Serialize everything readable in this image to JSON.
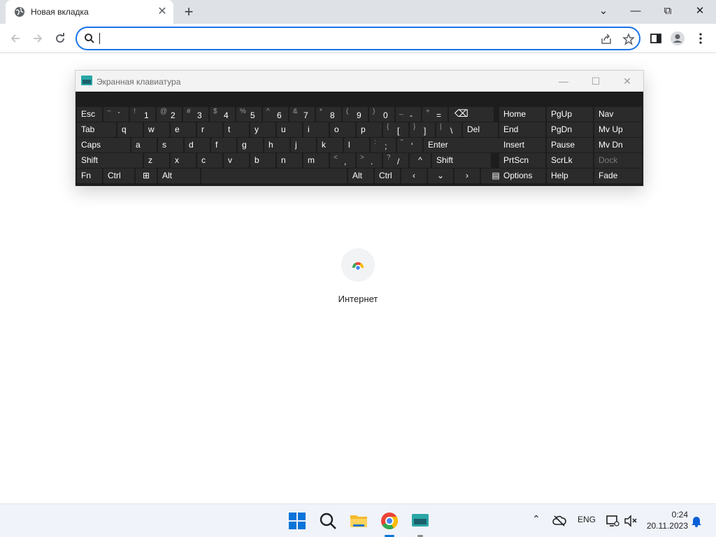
{
  "browser": {
    "tab_title": "Новая вкладка",
    "tab_close": "✕",
    "new_tab": "+",
    "window_controls": {
      "tabsearch": "⌄",
      "minimize": "—",
      "restore": "⧉",
      "close": "✕"
    },
    "omnibox": {
      "value": "",
      "placeholder": ""
    }
  },
  "osk": {
    "title": "Экранная клавиатура",
    "controls": {
      "minimize": "—",
      "maximize": "☐",
      "close": "✕"
    },
    "row1": [
      {
        "main": "Esc"
      },
      {
        "shift": "~",
        "main": "`"
      },
      {
        "shift": "!",
        "main": "1"
      },
      {
        "shift": "@",
        "main": "2"
      },
      {
        "shift": "#",
        "main": "3"
      },
      {
        "shift": "$",
        "main": "4"
      },
      {
        "shift": "%",
        "main": "5"
      },
      {
        "shift": "^",
        "main": "6"
      },
      {
        "shift": "&",
        "main": "7"
      },
      {
        "shift": "*",
        "main": "8"
      },
      {
        "shift": "(",
        "main": "9"
      },
      {
        "shift": ")",
        "main": "0"
      },
      {
        "shift": "_",
        "main": "-"
      },
      {
        "shift": "+",
        "main": "="
      },
      {
        "main": "⌫"
      }
    ],
    "row2": [
      "Tab",
      "q",
      "w",
      "e",
      "r",
      "t",
      "y",
      "u",
      "i",
      "o",
      "p",
      "[",
      "]",
      "\\",
      "Del"
    ],
    "row2_shift": [
      "",
      "",
      "",
      "",
      "",
      "",
      "",
      "",
      "",
      "",
      "",
      "{",
      "}",
      "|",
      ""
    ],
    "row3": [
      "Caps",
      "a",
      "s",
      "d",
      "f",
      "g",
      "h",
      "j",
      "k",
      "l",
      ";",
      "'",
      "Enter"
    ],
    "row3_shift": [
      "",
      "",
      "",
      "",
      "",
      "",
      "",
      "",
      "",
      "",
      ":",
      "\"",
      ""
    ],
    "row4": [
      "Shift",
      "z",
      "x",
      "c",
      "v",
      "b",
      "n",
      "m",
      ",",
      ".",
      "/",
      "^",
      "Shift"
    ],
    "row4_shift": [
      "",
      "",
      "",
      "",
      "",
      "",
      "",
      "",
      "<",
      ">",
      "?",
      "",
      ""
    ],
    "row5": [
      "Fn",
      "Ctrl",
      "⊞",
      "Alt",
      "",
      "Alt",
      "Ctrl",
      "‹",
      "⌄",
      "›",
      "▤"
    ],
    "nav": [
      [
        "Home",
        "PgUp",
        "Nav"
      ],
      [
        "End",
        "PgDn",
        "Mv Up"
      ],
      [
        "Insert",
        "Pause",
        "Mv Dn"
      ],
      [
        "PrtScn",
        "ScrLk",
        "Dock"
      ],
      [
        "Options",
        "Help",
        "Fade"
      ]
    ]
  },
  "newtab": {
    "shortcut_label": "Интернет"
  },
  "taskbar": {
    "lang": "ENG",
    "time": "0:24",
    "date": "20.11.2023",
    "tray_chevron": "⌃"
  }
}
